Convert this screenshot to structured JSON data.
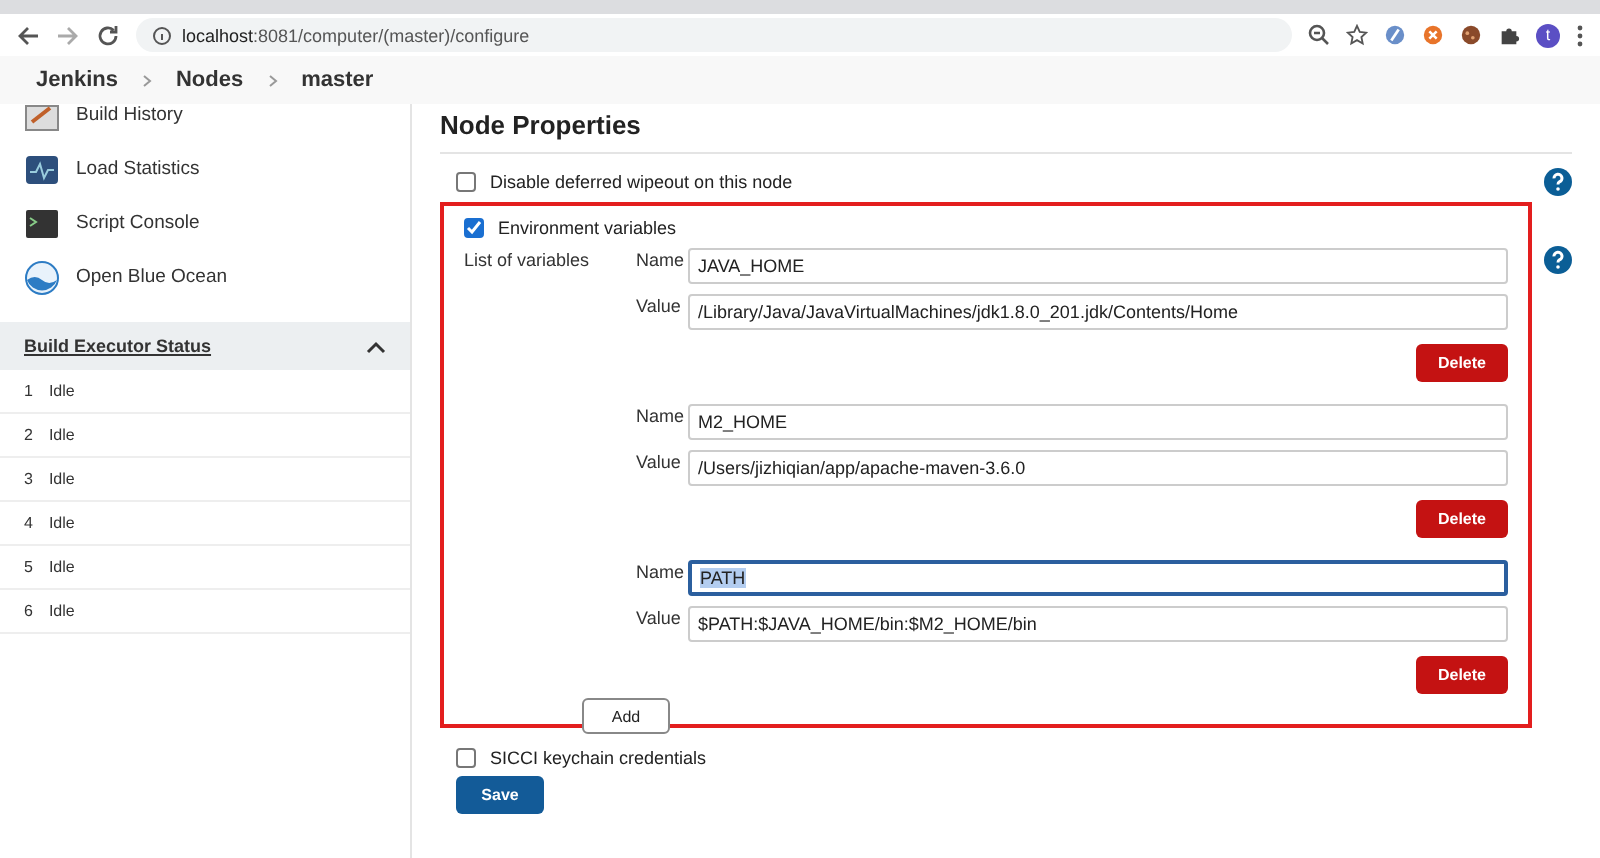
{
  "browser": {
    "url_host": "localhost",
    "url_rest": ":8081/computer/(master)/configure",
    "profile_initial": "t"
  },
  "breadcrumbs": [
    "Jenkins",
    "Nodes",
    "master"
  ],
  "sidebar": {
    "items": [
      {
        "label": "Build History",
        "kind": "history"
      },
      {
        "label": "Load Statistics",
        "kind": "chart"
      },
      {
        "label": "Script Console",
        "kind": "console"
      },
      {
        "label": "Open Blue Ocean",
        "kind": "ocean"
      }
    ],
    "executor_status": {
      "title": "Build Executor Status",
      "expanded": true,
      "executors": [
        {
          "number": "1",
          "status": "Idle"
        },
        {
          "number": "2",
          "status": "Idle"
        },
        {
          "number": "3",
          "status": "Idle"
        },
        {
          "number": "4",
          "status": "Idle"
        },
        {
          "number": "5",
          "status": "Idle"
        },
        {
          "number": "6",
          "status": "Idle"
        }
      ]
    }
  },
  "section_title": "Node Properties",
  "options_before": [
    {
      "label": "Disable deferred wipeout on this node",
      "checked": false
    }
  ],
  "env": {
    "label": "Environment variables",
    "checked": true,
    "list_label": "List of variables",
    "add_label": "Add",
    "variables": [
      {
        "name_label": "Name",
        "name": "JAVA_HOME",
        "value_label": "Value",
        "value": "/Library/Java/JavaVirtualMachines/jdk1.8.0_201.jdk/Contents/Home",
        "delete_label": "Delete",
        "focused": false
      },
      {
        "name_label": "Name",
        "name": "M2_HOME",
        "value_label": "Value",
        "value": "/Users/jizhiqian/app/apache-maven-3.6.0",
        "delete_label": "Delete",
        "focused": false
      },
      {
        "name_label": "Name",
        "name": "PATH",
        "value_label": "Value",
        "value": "$PATH:$JAVA_HOME/bin:$M2_HOME/bin",
        "delete_label": "Delete",
        "focused": true
      }
    ]
  },
  "options_after": [
    {
      "label": "SICCI keychain credentials",
      "checked": false
    }
  ],
  "save_label": "Save"
}
